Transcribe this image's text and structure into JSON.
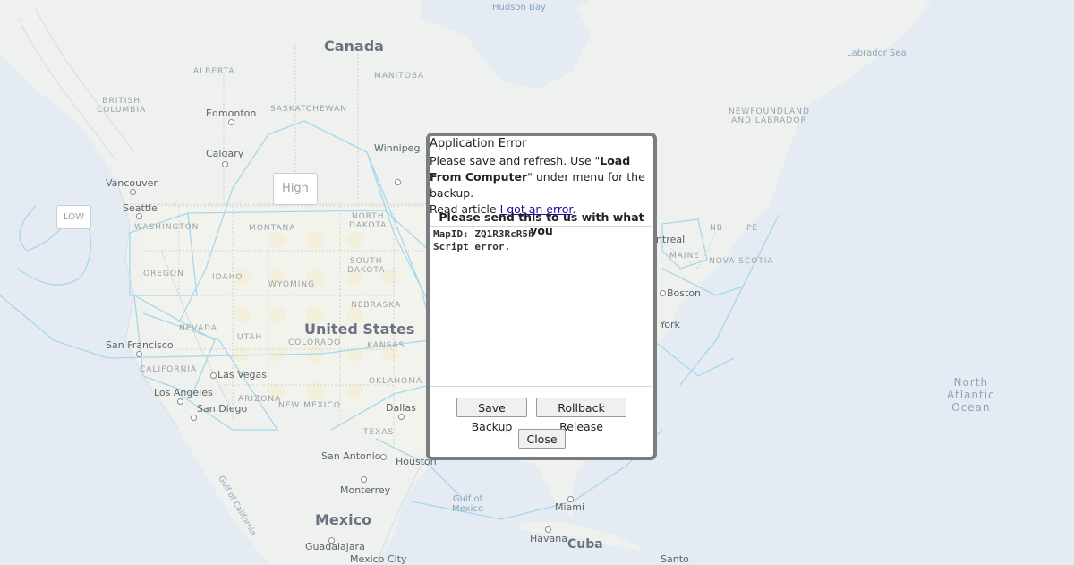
{
  "map": {
    "countries": {
      "canada": "Canada",
      "united_states": "United States",
      "mexico": "Mexico",
      "cuba": "Cuba"
    },
    "water": {
      "hudson_bay": "Hudson Bay",
      "labrador_sea": "Labrador Sea",
      "north_atlantic_ocean": "North\nAtlantic\nOcean",
      "gulf_of_mexico": "Gulf of\nMexico",
      "gulf_of_california": "Gulf of California"
    },
    "regions": {
      "alberta": "ALBERTA",
      "manitoba": "MANITOBA",
      "british_columbia": "BRITISH\nCOLUMBIA",
      "saskatchewan": "SASKATCHEWAN",
      "newfoundland": "NEWFOUNDLAND\nAND LABRADOR",
      "washington": "WASHINGTON",
      "oregon": "OREGON",
      "idaho": "IDAHO",
      "montana": "MONTANA",
      "north_dakota": "NORTH\nDAKOTA",
      "south_dakota": "SOUTH\nDAKOTA",
      "wyoming": "WYOMING",
      "nebraska": "NEBRASKA",
      "nevada": "NEVADA",
      "utah": "UTAH",
      "colorado": "COLORADO",
      "kansas": "KANSAS",
      "california": "CALIFORNIA",
      "arizona": "ARIZONA",
      "new_mexico": "NEW MEXICO",
      "oklahoma": "OKLAHOMA",
      "texas": "TEXAS",
      "maine": "MAINE",
      "nb": "NB",
      "nova_scotia": "NOVA SCOTIA",
      "pe": "PE"
    },
    "cities": {
      "edmonton": "Edmonton",
      "calgary": "Calgary",
      "vancouver": "Vancouver",
      "seattle": "Seattle",
      "winnipeg": "Winnipeg",
      "san_francisco": "San Francisco",
      "las_vegas": "Las Vegas",
      "los_angeles": "Los Angeles",
      "san_diego": "San Diego",
      "dallas": "Dallas",
      "san_antonio": "San Antonio",
      "houston": "Houston",
      "monterrey": "Monterrey",
      "guadalajara": "Guadalajara",
      "mexico_city": "Mexico City",
      "miami": "Miami",
      "havana": "Havana",
      "santo": "Santo",
      "boston": "Boston",
      "york": "York",
      "ntreal": "ntreal"
    },
    "markers": {
      "high": "High",
      "low": "LOW"
    }
  },
  "dialog": {
    "title": "Application Error",
    "msg_part1": "Please save and refresh. Use \"",
    "msg_bold": "Load From Computer",
    "msg_part2": "\" under menu for the backup.",
    "msg_read": "Read article ",
    "msg_link": "I got an error",
    "msg_end": ".",
    "send_text": "Please send this to us with what you",
    "log_text": "MapID: ZQ1R3RcR5h\nScript error.",
    "save_backup_label": "Save Backup",
    "rollback_label": "Rollback Release",
    "close_label": "Close"
  }
}
